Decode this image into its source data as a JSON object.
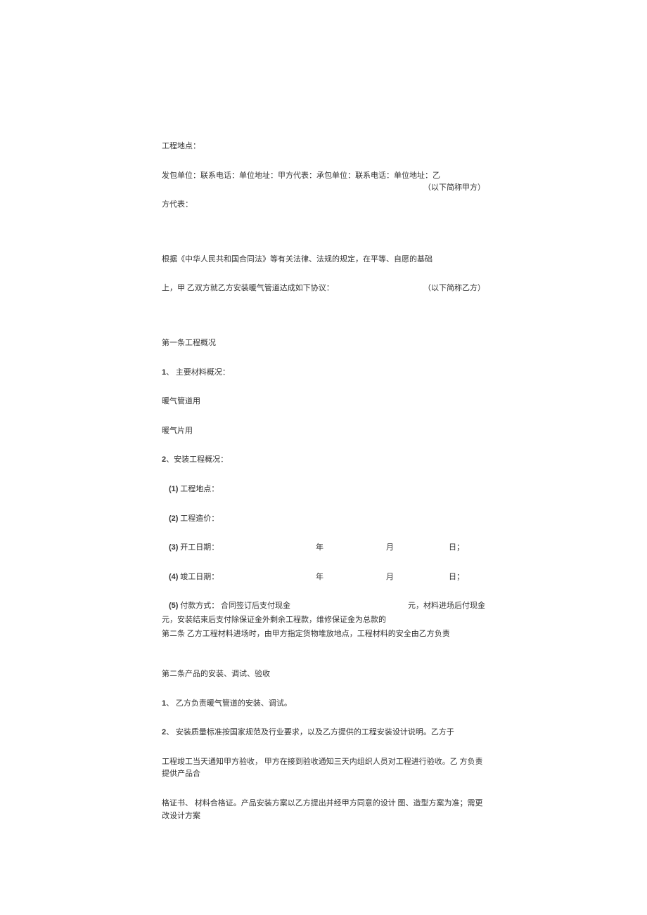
{
  "line1": "工程地点：",
  "line2_left": "发包单位：联系电话：单位地址：甲方代表：承包单位：联系电话：单位地址：乙",
  "line2_right": "（以下简称甲方）",
  "line3": "方代表：",
  "line4": "根据《中华人民共和国合同法》等有关法律、法规的规定，在平等、自愿的基础",
  "line5_left": "上，甲 乙双方就乙方安装暖气管道达成如下协议：",
  "line5_right": "（以下简称乙方）",
  "article1_title": "第一条工程概况",
  "item1_num": "1",
  "item1_text": "、 主要材料概况：",
  "pipe_use": "暖气管道用",
  "radiator_use": "暖气片用",
  "item2_num": "2",
  "item2_text": "、安装工程概况：",
  "sub1_num": "(1)",
  "sub1_text": " 工程地点：",
  "sub2_num": "(2)",
  "sub2_text": " 工程造价：",
  "sub3_num": "(3)",
  "sub3_text": " 开工日期：",
  "sub4_num": "(4)",
  "sub4_text": " 竣工日期：",
  "year": "年",
  "month": "月",
  "day": "日；",
  "sub5_num": "(5)",
  "sub5_text": "  付款方式： 合同签订后支付现金",
  "sub5_right": "元，材料进场后付现金",
  "sub5_line2": "元，安装结束后支付除保证金外剩余工程款，维修保证金为总款的",
  "sub5_line3": "第二条 乙方工程材料进场时，由甲方指定货物堆放地点，工程材料的安全由乙方负责",
  "article2_title": "第二条产品的安装、调试、验收",
  "a2_item1_num": "1",
  "a2_item1_text": "、 乙方负责暖气管道的安装、调试。",
  "a2_item2_num": "2",
  "a2_item2_text": "、 安装质量标准按国家规范及行业要求，以及乙方提供的工程安装设计说明。乙方于",
  "a2_line3": "工程竣工当天通知甲方验收， 甲方在接到验收通知三天内组织人员对工程进行验收。乙 方负责提供产品合",
  "a2_line4": "格证书、 材料合格证。产品安装方案以乙方提出并经甲方同意的设计 图、造型方案为准；需更改设计方案"
}
